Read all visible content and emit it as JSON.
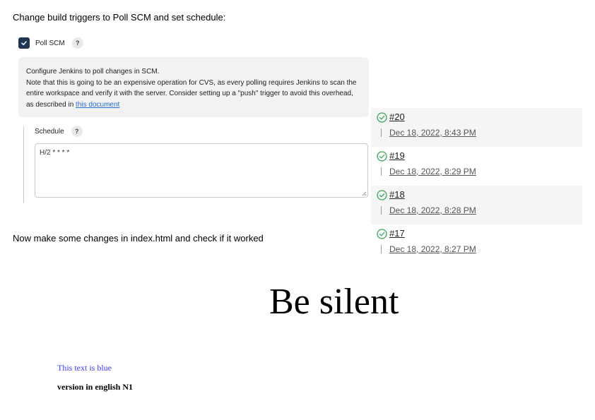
{
  "intro_text": "Change build triggers to Poll SCM and set schedule:",
  "poll_scm": {
    "checked": true,
    "label": "Poll SCM",
    "help": "?"
  },
  "info": {
    "line1": "Configure Jenkins to poll changes in SCM.",
    "line2_prefix": "Note that this is going to be an expensive operation for CVS, as every polling requires Jenkins to scan the entire workspace and verify it with the server. Consider setting up a \"push\" trigger to avoid this overhead, as described in ",
    "link_text": "this document"
  },
  "schedule": {
    "label": "Schedule",
    "help": "?",
    "value": "H/2 * * * *"
  },
  "builds": [
    {
      "number": "#20",
      "date": "Dec 18, 2022, 8:43 PM",
      "status": "success"
    },
    {
      "number": "#19",
      "date": "Dec 18, 2022, 8:29 PM",
      "status": "success"
    },
    {
      "number": "#18",
      "date": "Dec 18, 2022, 8:28 PM",
      "status": "success"
    },
    {
      "number": "#17",
      "date": "Dec 18, 2022, 8:27 PM",
      "status": "success"
    }
  ],
  "now_text": "Now make some changes in index.html and check if it worked",
  "page_preview": {
    "heading": "Be silent",
    "blue_text": "This text is blue",
    "version_text": "version in english N1"
  },
  "colors": {
    "checkbox": "#1e3654",
    "link": "#2a6bd6",
    "success": "#3aa35a",
    "blue_text": "#3b3bff"
  }
}
